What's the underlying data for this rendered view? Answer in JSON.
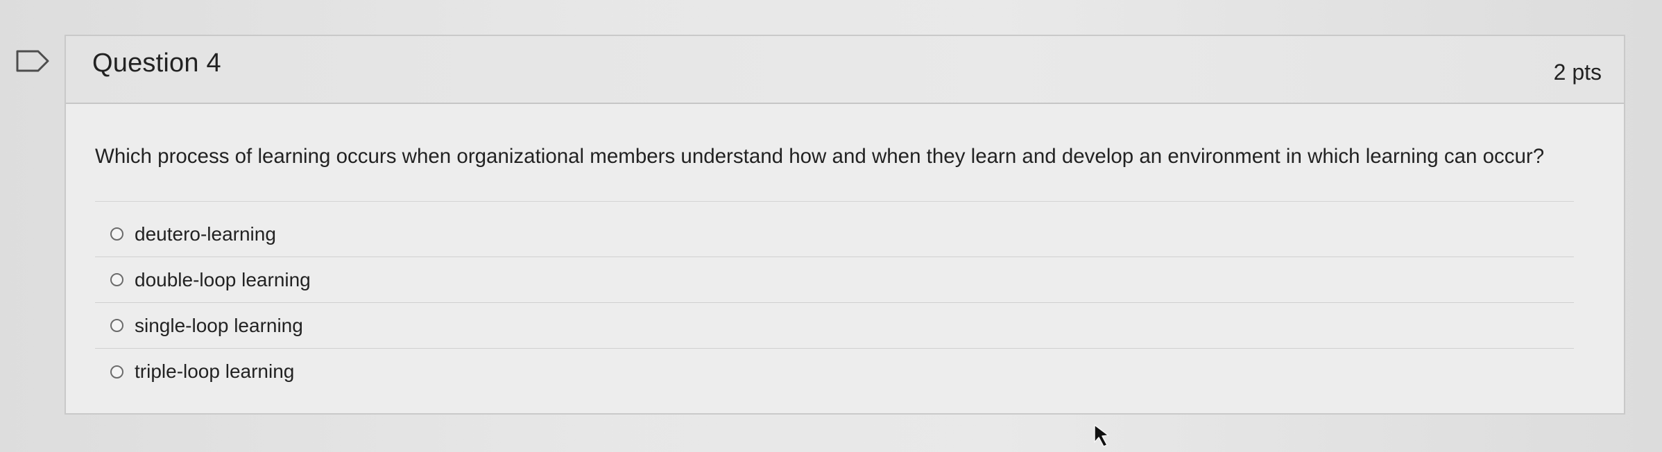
{
  "question": {
    "title": "Question 4",
    "points": "2 pts",
    "text": "Which process of learning occurs when organizational members understand how and when they learn and develop an environment in which learning can occur?",
    "answers": [
      {
        "label": "deutero-learning",
        "selected": false
      },
      {
        "label": "double-loop learning",
        "selected": false
      },
      {
        "label": "single-loop learning",
        "selected": false
      },
      {
        "label": "triple-loop learning",
        "selected": false
      }
    ]
  },
  "icons": {
    "flag": "bookmark-flag-icon",
    "radio": "radio-button-icon",
    "cursor": "mouse-pointer-icon"
  },
  "colors": {
    "background": "#e7e7e7",
    "card_border": "#c9c9c9",
    "text": "#222222"
  }
}
